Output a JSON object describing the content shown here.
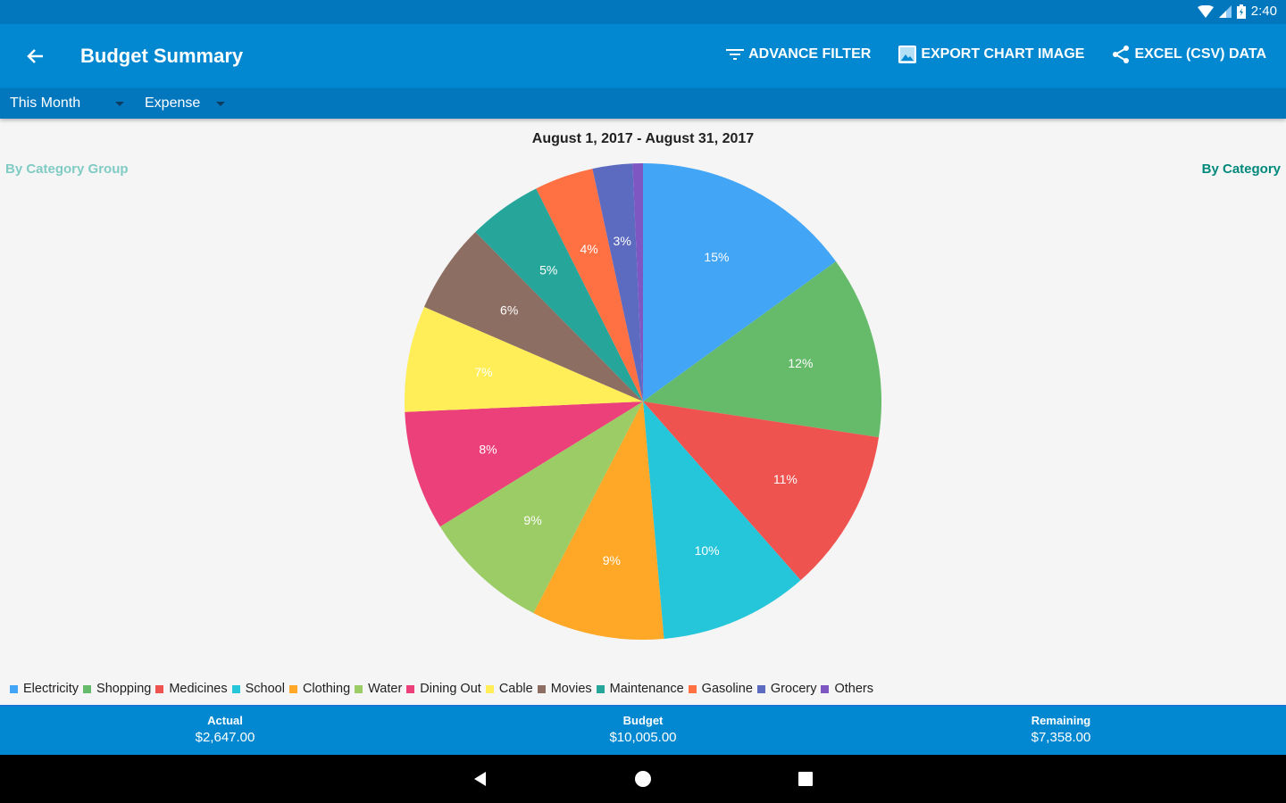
{
  "status_bar": {
    "time": "2:40"
  },
  "app_bar": {
    "title": "Budget Summary",
    "actions": [
      {
        "label": "ADVANCE FILTER",
        "icon": "filter-icon"
      },
      {
        "label": "EXPORT CHART IMAGE",
        "icon": "image-icon"
      },
      {
        "label": "EXCEL (CSV) DATA",
        "icon": "share-icon"
      }
    ]
  },
  "filters": {
    "period": "This Month",
    "type": "Expense"
  },
  "view_toggle": {
    "left": "By Category Group",
    "right": "By Category"
  },
  "colors": {
    "primary": "#0288d1",
    "primary_dark": "#0277bd",
    "toggle_inactive": "#80cbc4",
    "toggle_active": "#00897b"
  },
  "chart_data": {
    "type": "pie",
    "title": "August 1, 2017 - August 31, 2017",
    "categories": [
      "Electricity",
      "Shopping",
      "Medicines",
      "School",
      "Clothing",
      "Water",
      "Dining Out",
      "Cable",
      "Movies",
      "Maintenance",
      "Gasoline",
      "Grocery",
      "Others"
    ],
    "values": [
      15.0,
      12.4,
      11.1,
      10.1,
      9.0,
      8.6,
      8.1,
      7.2,
      6.1,
      5.0,
      4.0,
      2.7,
      0.7
    ],
    "labels": [
      "15%",
      "12%",
      "11%",
      "10%",
      "9%",
      "9%",
      "8%",
      "7%",
      "6%",
      "5%",
      "4%",
      "3%",
      ""
    ],
    "colors": [
      "#42a5f5",
      "#66bb6a",
      "#ef5350",
      "#26c6da",
      "#ffa726",
      "#9ccc65",
      "#ec407a",
      "#ffee58",
      "#8d6e63",
      "#26a69a",
      "#ff7043",
      "#5c6bc0",
      "#7e57c2"
    ],
    "legend": "bottom-left"
  },
  "summary": {
    "actual_label": "Actual",
    "actual_value": "$2,647.00",
    "budget_label": "Budget",
    "budget_value": "$10,005.00",
    "remaining_label": "Remaining",
    "remaining_value": "$7,358.00"
  }
}
